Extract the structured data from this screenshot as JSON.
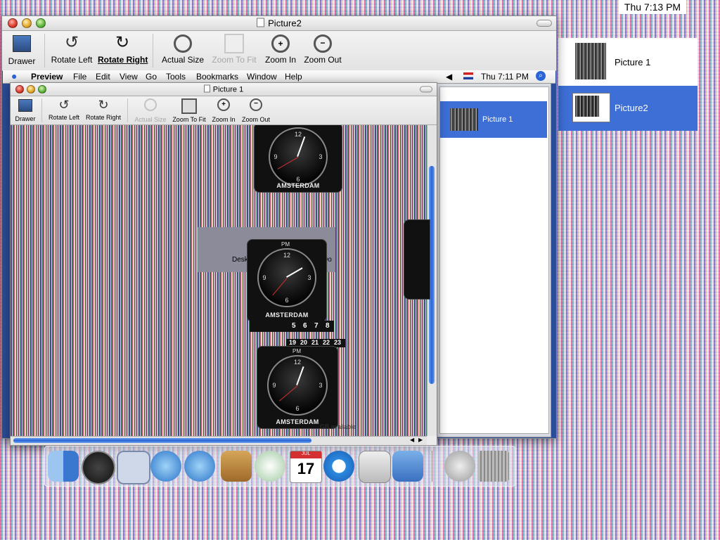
{
  "system": {
    "clock": "Thu 7:13 PM"
  },
  "window_picture2": {
    "title": "Picture2",
    "toolbar": {
      "drawer": "Drawer",
      "rotate_left": "Rotate Left",
      "rotate_right": "Rotate Right",
      "actual_size": "Actual Size",
      "zoom_to_fit": "Zoom To Fit",
      "zoom_in": "Zoom In",
      "zoom_out": "Zoom Out"
    }
  },
  "drawer_list": {
    "items": [
      {
        "label": "Picture 1",
        "selected": false
      },
      {
        "label": "Picture2",
        "selected": true
      }
    ]
  },
  "inner_menubar": {
    "app": "Preview",
    "items": [
      "File",
      "Edit",
      "View",
      "Go",
      "Tools",
      "Bookmarks",
      "Window",
      "Help"
    ],
    "clock": "Thu 7:11 PM"
  },
  "window_picture1": {
    "title": "Picture 1",
    "toolbar": {
      "drawer": "Drawer",
      "rotate_left": "Rotate Left",
      "rotate_right": "Rotate Right",
      "actual_size": "Actual Size",
      "zoom_to_fit": "Zoom To Fit",
      "zoom_in": "Zoom In",
      "zoom_out": "Zoom Out"
    },
    "clock_widgets": [
      {
        "city": "AMSTERDAM"
      },
      {
        "city": "AMSTERDAM",
        "pm": "PM"
      },
      {
        "city": "AMSTERDAM",
        "pm": "PM"
      }
    ],
    "fragments": {
      "desk": "Desk",
      "do": "Do",
      "calendar_row": [
        "5",
        "6",
        "7",
        "8"
      ],
      "calendar_row2": [
        "19",
        "20",
        "21",
        "22",
        "23"
      ],
      "available": "GB available"
    }
  },
  "inner_drawer": {
    "items": [
      {
        "label": "Picture 1",
        "selected": true
      }
    ]
  },
  "dock": {
    "icons": [
      "finder-icon",
      "dashboard-icon",
      "mail-icon",
      "safari-icon",
      "ichat-icon",
      "address-book-icon",
      "itunes-icon",
      "ical-icon",
      "quicktime-icon",
      "system-preferences-icon",
      "preview-icon",
      "downloads-icon",
      "trash-icon"
    ],
    "ical_month": "JUL",
    "ical_day": "17"
  },
  "colors": {
    "selection": "#3d6fd6",
    "accent": "#2a62d8"
  }
}
